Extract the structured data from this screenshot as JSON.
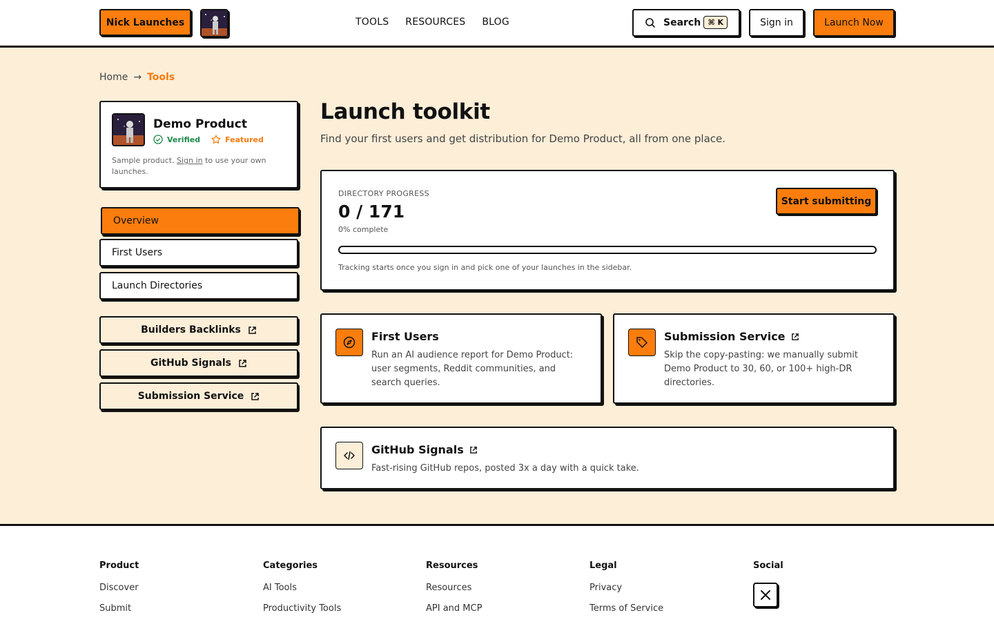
{
  "header": {
    "brand": "Nick Launches",
    "nav": [
      "TOOLS",
      "RESOURCES",
      "BLOG"
    ],
    "search_label": "Search",
    "search_shortcut": "⌘ K",
    "signin_label": "Sign in",
    "launch_label": "Launch Now"
  },
  "breadcrumb": {
    "home": "Home",
    "arrow": "→",
    "current": "Tools"
  },
  "product": {
    "name": "Demo Product",
    "verified": "Verified",
    "featured": "Featured",
    "note_pre": "Sample product.",
    "note_link": "Sign in",
    "note_post": "to use your own launches."
  },
  "sidebar": {
    "items": [
      {
        "label": "Overview",
        "active": true
      },
      {
        "label": "First Users",
        "active": false
      },
      {
        "label": "Launch Directories",
        "active": false
      }
    ],
    "links": [
      {
        "label": "Builders Backlinks"
      },
      {
        "label": "GitHub Signals"
      },
      {
        "label": "Submission Service"
      }
    ]
  },
  "main": {
    "title": "Launch toolkit",
    "subtitle": "Find your first users and get distribution for Demo Product, all from one place."
  },
  "progress": {
    "label": "DIRECTORY PROGRESS",
    "count": "0 / 171",
    "percent_text": "0% complete",
    "fraction": 0,
    "note": "Tracking starts once you sign in and pick one of your launches in the sidebar.",
    "button": "Start submitting"
  },
  "cards": [
    {
      "title": "First Users",
      "desc": "Run an AI audience report for Demo Product: user segments, Reddit communities, and search queries.",
      "icon": "compass-icon"
    },
    {
      "title": "Submission Service",
      "desc": "Skip the copy-pasting: we manually submit Demo Product to 30, 60, or 100+ high-DR directories.",
      "icon": "tag-icon"
    },
    {
      "title": "GitHub Signals",
      "desc": "Fast-rising GitHub repos, posted 3x a day with a quick take.",
      "icon": "code-icon"
    }
  ],
  "footer": {
    "product": {
      "heading": "Product",
      "links": [
        "Discover",
        "Submit"
      ]
    },
    "categories": {
      "heading": "Categories",
      "links": [
        "AI Tools",
        "Productivity Tools"
      ]
    },
    "resources": {
      "heading": "Resources",
      "links": [
        "Resources",
        "API and MCP"
      ]
    },
    "legal": {
      "heading": "Legal",
      "links": [
        "Privacy",
        "Terms of Service"
      ]
    },
    "social": {
      "heading": "Social",
      "icon": "x-logo-icon"
    }
  },
  "colors": {
    "accent": "#fb7d0d",
    "cream": "#fdeed8",
    "verified": "#1b8a4a"
  }
}
